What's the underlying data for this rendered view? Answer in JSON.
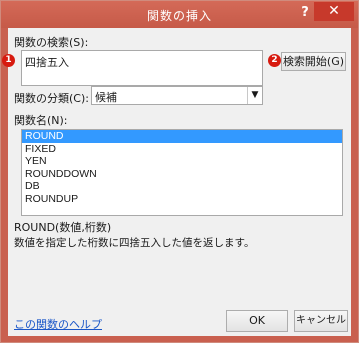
{
  "window": {
    "title": "関数の挿入",
    "help_label": "?",
    "close_label": "✕"
  },
  "search": {
    "label": "関数の検索(S):",
    "value": "四捨五入",
    "button_label": "検索開始(G)",
    "marker1": "1",
    "marker2": "2"
  },
  "category": {
    "label": "関数の分類(C):",
    "selected": "候補"
  },
  "functions": {
    "label": "関数名(N):",
    "items": [
      "ROUND",
      "FIXED",
      "YEN",
      "ROUNDDOWN",
      "DB",
      "ROUNDUP"
    ],
    "selected_index": 0
  },
  "description": {
    "signature": "ROUND(数値,桁数)",
    "text": "数値を指定した桁数に四捨五入した値を返します。"
  },
  "footer": {
    "help_link": "この関数のヘルプ",
    "ok_label": "OK",
    "cancel_label": "キャンセル"
  },
  "colors": {
    "titlebar": "#c65a48",
    "close_button": "#c7392b",
    "selection": "#3399ff",
    "marker": "#d71a0f"
  }
}
